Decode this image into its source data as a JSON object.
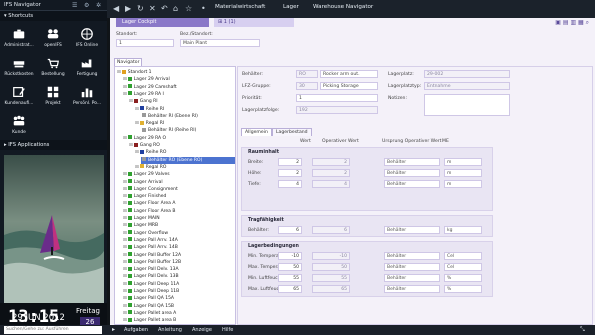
{
  "sidebar": {
    "title": "IFS Navigator",
    "shortcuts_title": "Shortcuts",
    "tiles": [
      {
        "label": "Administrat...",
        "icon": "briefcase-icon"
      },
      {
        "label": "openIFS",
        "icon": "people-icon"
      },
      {
        "label": "IFS Online",
        "icon": "globe-icon"
      },
      {
        "label": "Rückstkosten",
        "icon": "stapler-icon"
      },
      {
        "label": "Bestellung",
        "icon": "cart-icon"
      },
      {
        "label": "Fertigung",
        "icon": "factory-icon"
      },
      {
        "label": "Kundenaufi...",
        "icon": "edit-icon"
      },
      {
        "label": "Projekt",
        "icon": "grid-icon"
      },
      {
        "label": "Persönl. Po...",
        "icon": "chart-icon"
      },
      {
        "label": "Kunde",
        "icon": "group-icon"
      }
    ],
    "apps_title": "IFS Applications",
    "time": "13:15",
    "weekday": "Freitag",
    "day_num": "26",
    "date": "29 JUN 2012"
  },
  "topbar": {
    "tabs": [
      "Materialwirtschaft",
      "Lager",
      "Warehouse Navigator"
    ]
  },
  "content": {
    "tab_active": "Lager Cockpit",
    "tab_count": "1 (1)",
    "standort_label": "Standort:",
    "standort_value": "1",
    "bez_label": "Bez./Standort:",
    "bez_value": "Main Plant",
    "navigator_tab": "Navigator"
  },
  "tree": [
    {
      "label": "Standort 1",
      "indent": 0,
      "color": "#e0a020"
    },
    {
      "label": "Lager 29 Arrival",
      "indent": 1,
      "color": "#30a030"
    },
    {
      "label": "Lager 29 Camshaft",
      "indent": 1,
      "color": "#30a030"
    },
    {
      "label": "Lager 29 RA I",
      "indent": 1,
      "color": "#30a030"
    },
    {
      "label": "Gang RI",
      "indent": 2,
      "color": "#8a2020"
    },
    {
      "label": "Reihe RI",
      "indent": 3,
      "color": "#2040a0"
    },
    {
      "label": "Behälter RI (Ebene RI)",
      "indent": 4,
      "color": "#999999"
    },
    {
      "label": "Regal RI",
      "indent": 3,
      "color": "#e0b030"
    },
    {
      "label": "Behälter RI (Reihe RI)",
      "indent": 4,
      "color": "#999999"
    },
    {
      "label": "Lager 29 RA O",
      "indent": 1,
      "color": "#30a030"
    },
    {
      "label": "Gang RO",
      "indent": 2,
      "color": "#8a2020"
    },
    {
      "label": "Reihe RO",
      "indent": 3,
      "color": "#2040a0"
    },
    {
      "label": "Behälter RO (Ebene RO)",
      "indent": 4,
      "color": "#999999",
      "selected": true
    },
    {
      "label": "Regal RO",
      "indent": 3,
      "color": "#e0b030"
    },
    {
      "label": "Lager 29 Valves",
      "indent": 1,
      "color": "#30a030"
    },
    {
      "label": "Lager Arrival",
      "indent": 1,
      "color": "#30a030"
    },
    {
      "label": "Lager Consignment",
      "indent": 1,
      "color": "#30a030"
    },
    {
      "label": "Lager Finished",
      "indent": 1,
      "color": "#30a030"
    },
    {
      "label": "Lager Floor Area A",
      "indent": 1,
      "color": "#30a030"
    },
    {
      "label": "Lager Floor Area B",
      "indent": 1,
      "color": "#30a030"
    },
    {
      "label": "Lager MAIN",
      "indent": 1,
      "color": "#30a030"
    },
    {
      "label": "Lager MRB",
      "indent": 1,
      "color": "#30a030"
    },
    {
      "label": "Lager Overflow",
      "indent": 1,
      "color": "#30a030"
    },
    {
      "label": "Lager Pall Arrv. 14A",
      "indent": 1,
      "color": "#30a030"
    },
    {
      "label": "Lager Pall Arrv. 14B",
      "indent": 1,
      "color": "#30a030"
    },
    {
      "label": "Lager Pall Buffer 12A",
      "indent": 1,
      "color": "#30a030"
    },
    {
      "label": "Lager Pall Buffer 12B",
      "indent": 1,
      "color": "#30a030"
    },
    {
      "label": "Lager Pall Delv. 13A",
      "indent": 1,
      "color": "#30a030"
    },
    {
      "label": "Lager Pall Delv. 13B",
      "indent": 1,
      "color": "#30a030"
    },
    {
      "label": "Lager Pall Deep 11A",
      "indent": 1,
      "color": "#30a030"
    },
    {
      "label": "Lager Pall Deep 11B",
      "indent": 1,
      "color": "#30a030"
    },
    {
      "label": "Lager Pall QA 15A",
      "indent": 1,
      "color": "#30a030"
    },
    {
      "label": "Lager Pall QA 15B",
      "indent": 1,
      "color": "#30a030"
    },
    {
      "label": "Lager Pallet area A",
      "indent": 1,
      "color": "#30a030"
    },
    {
      "label": "Lager Pallet area B",
      "indent": 1,
      "color": "#30a030"
    }
  ],
  "detail": {
    "behaelter_label": "Behälter:",
    "behaelter_code": "RO",
    "behaelter_desc": "Rocker arm out.",
    "lfz_label": "LFZ-Gruppe:",
    "lfz_code": "30",
    "lfz_desc": "Picking Storage",
    "prio_label": "Priorität:",
    "prio_value": "1",
    "folge_label": "Lagerplatzfolge:",
    "folge_value": "192",
    "lagerplatz_label": "Lagerplatz:",
    "lagerplatz_value": "29-002",
    "typ_label": "Lagerplatztyp:",
    "typ_value": "Entnahme",
    "notizen_label": "Notizen:",
    "tabs": [
      "Allgemein",
      "Lagerbestand"
    ],
    "col_headers": [
      "Wert",
      "Operativer Wert",
      "Ursprung Operativer Wert",
      "ME"
    ],
    "groups": [
      {
        "title": "Rauminhalt",
        "rows": [
          {
            "label": "Breite:",
            "wert": "2",
            "op": "2",
            "urs": "Behälter",
            "me": "m"
          },
          {
            "label": "Höhe:",
            "wert": "2",
            "op": "2",
            "urs": "Behälter",
            "me": "m"
          },
          {
            "label": "Tiefe:",
            "wert": "4",
            "op": "4",
            "urs": "Behälter",
            "me": "m"
          }
        ]
      },
      {
        "title": "Tragfähigkeit",
        "rows": [
          {
            "label": "Behälter:",
            "wert": "6",
            "op": "6",
            "urs": "Behälter",
            "me": "kg"
          }
        ]
      },
      {
        "title": "Lagerbedingungen",
        "rows": [
          {
            "label": "Min. Temperatur:",
            "wert": "-10",
            "op": "-10",
            "urs": "Behälter",
            "me": "Cel"
          },
          {
            "label": "Max. Temperatur:",
            "wert": "50",
            "op": "50",
            "urs": "Behälter",
            "me": "Cel"
          },
          {
            "label": "Min. Luftfeuchtigkeit:",
            "wert": "55",
            "op": "55",
            "urs": "Behälter",
            "me": "%"
          },
          {
            "label": "Max. Luftfeuchtigkeit:",
            "wert": "65",
            "op": "65",
            "urs": "Behälter",
            "me": "%"
          }
        ]
      }
    ]
  },
  "bottom": {
    "search_placeholder": "Suchen/Gehe zu: Ausführen",
    "items": [
      "Aufgaben",
      "Anleitung",
      "Anzeige",
      "Hilfe"
    ]
  }
}
